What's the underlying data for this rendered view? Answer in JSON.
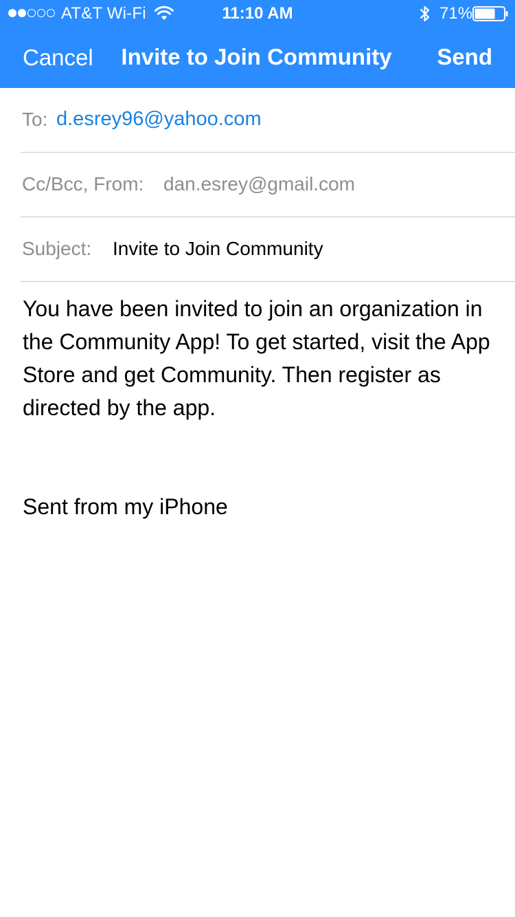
{
  "status_bar": {
    "signal_dots_filled": 2,
    "signal_dots_total": 5,
    "carrier": "AT&T Wi-Fi",
    "time": "11:10 AM",
    "battery_percent": "71%",
    "battery_level": 0.71,
    "icons": [
      "wifi-icon",
      "bluetooth-icon",
      "battery-icon"
    ]
  },
  "nav": {
    "cancel_label": "Cancel",
    "title": "Invite to Join Community",
    "send_label": "Send"
  },
  "compose": {
    "to_label": "To:",
    "to_value": "d.esrey96@yahoo.com",
    "ccbcc_label": "Cc/Bcc, From:",
    "from_value": "dan.esrey@gmail.com",
    "subject_label": "Subject:",
    "subject_value": "Invite to Join Community",
    "body": "You have been invited to join an organization in the Community App! To get started, visit the App Store and get Community. Then register as directed by the app.",
    "signature": "Sent from my iPhone"
  },
  "colors": {
    "header_bg": "#2a8cff",
    "link_blue": "#1a82e2",
    "secondary_text": "#8e8e93",
    "separator": "#c8c7cc"
  }
}
